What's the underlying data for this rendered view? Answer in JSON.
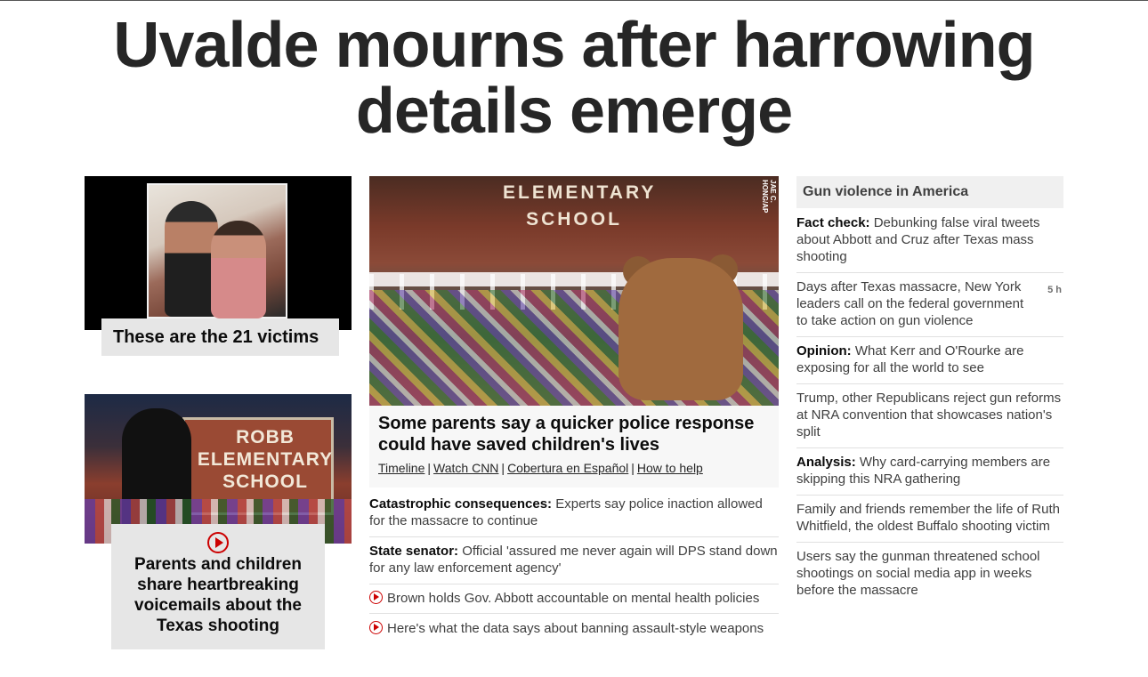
{
  "headline": {
    "line1": "Uvalde mourns after harrowing",
    "line2": "details emerge"
  },
  "left": {
    "victims_label": "These are the 21 victims",
    "voicemail_title": "Parents and children share heartbreaking voicemails about the Texas shooting",
    "voicemail_sign_text": [
      "ROBB",
      "ELEMENTARY",
      "SCHOOL"
    ]
  },
  "center": {
    "image_sign_text": [
      "ELEMENTARY",
      "SCHOOL"
    ],
    "image_credit": "JAE C. HONG/AP",
    "title": "Some parents say a quicker police response could have saved children's lives",
    "links": [
      "Timeline",
      "Watch CNN",
      "Cobertura en Español",
      "How to help"
    ],
    "items": [
      {
        "prefix": "Catastrophic consequences:",
        "text": "Experts say police inaction allowed for the massacre to continue",
        "video": false
      },
      {
        "prefix": "State senator:",
        "text": "Official 'assured me never again will DPS stand down for any law enforcement agency'",
        "video": false
      },
      {
        "prefix": "",
        "text": "Brown holds Gov. Abbott accountable on mental health policies",
        "video": true
      },
      {
        "prefix": "",
        "text": "Here's what the data says about banning assault-style weapons",
        "video": true
      }
    ]
  },
  "right": {
    "section_title": "Gun violence in America",
    "items": [
      {
        "prefix": "Fact check:",
        "text": "Debunking false viral tweets about Abbott and Cruz after Texas mass shooting",
        "timestamp": ""
      },
      {
        "prefix": "",
        "text": "Days after Texas massacre, New York leaders call on the federal government to take action on gun violence",
        "timestamp": "5 h"
      },
      {
        "prefix": "Opinion:",
        "text": "What Kerr and O'Rourke are exposing for all the world to see",
        "timestamp": ""
      },
      {
        "prefix": "",
        "text": "Trump, other Republicans reject gun reforms at NRA convention that showcases nation's split",
        "timestamp": ""
      },
      {
        "prefix": "Analysis:",
        "text": "Why card-carrying members are skipping this NRA gathering",
        "timestamp": ""
      },
      {
        "prefix": "",
        "text": "Family and friends remember the life of Ruth Whitfield, the oldest Buffalo shooting victim",
        "timestamp": ""
      },
      {
        "prefix": "",
        "text": "Users say the gunman threatened school shootings on social media app in weeks before the massacre",
        "timestamp": ""
      }
    ]
  },
  "colors": {
    "accent_red": "#cc0000",
    "text_dark": "#262626",
    "label_bg": "#e6e6e6"
  }
}
